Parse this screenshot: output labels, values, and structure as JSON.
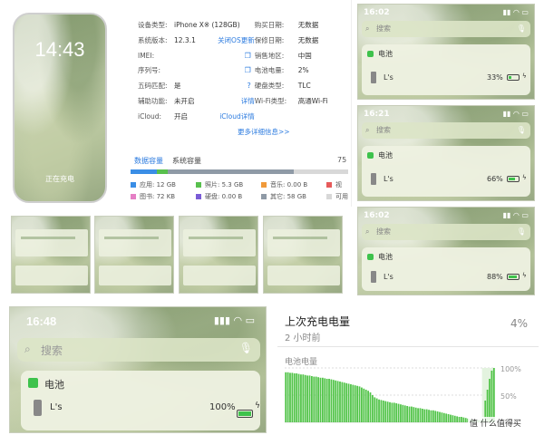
{
  "itools": {
    "lock_time": "14:43",
    "lock_status": "正在充电",
    "info": [
      {
        "k": "设备类型:",
        "v": "iPhone X※ (128GB)",
        "k2": "购买日期:",
        "v2": "无数据"
      },
      {
        "k": "系统版本:",
        "v": "12.3.1",
        "link": "关闭OS更新",
        "k2": "保修日期:",
        "v2": "无数据"
      },
      {
        "k": "IMEI:",
        "v": "",
        "copy": "❐",
        "k2": "销售地区:",
        "v2": "中国"
      },
      {
        "k": "序列号:",
        "v": "",
        "copy": "❐",
        "k2": "电池电量:",
        "v2": "2%"
      },
      {
        "k": "五码匹配:",
        "v": "是",
        "copy": "?",
        "k2": "硬盘类型:",
        "v2": "TLC"
      },
      {
        "k": "辅助功能:",
        "v": "未开启",
        "link": "详情",
        "k2": "Wi-Fi类型:",
        "v2": "高通Wi-Fi"
      },
      {
        "k": "iCloud:",
        "v": "开启",
        "link": "iCloud详情",
        "k2": "",
        "v2": ""
      }
    ],
    "more": "更多详细信息>>",
    "tab_data": "数据容量",
    "tab_system": "系统容量",
    "tab_total": "75",
    "legend": [
      {
        "label": "应用: 12 GB",
        "color": "#3a8ee6"
      },
      {
        "label": "照片: 5.3 GB",
        "color": "#58c04d"
      },
      {
        "label": "音乐: 0.00 B",
        "color": "#f09a3a"
      },
      {
        "label": "视",
        "color": "#e65a5a"
      },
      {
        "label": "图书: 72 KB",
        "color": "#e57fc5"
      },
      {
        "label": "硬盘: 0.00 B",
        "color": "#7a5cd6"
      },
      {
        "label": "其它: 58 GB",
        "color": "#8f9aa6"
      },
      {
        "label": "可用",
        "color": "#d8d8d8"
      }
    ]
  },
  "widgets_right": [
    {
      "time": "16:02",
      "percent": "33%",
      "level": 33
    },
    {
      "time": "16:21",
      "percent": "66%",
      "level": 66
    },
    {
      "time": "16:02",
      "percent": "88%",
      "level": 88
    }
  ],
  "widget_common": {
    "search_placeholder": "搜索",
    "battery_title": "电池",
    "device_label": "L's "
  },
  "big_widget": {
    "time": "16:48",
    "percent": "100%",
    "level": 100
  },
  "battery_panel": {
    "title": "上次充电电量",
    "value": "4%",
    "subtitle": "2 小时前",
    "chart_label": "电池电量",
    "y_ticks": [
      "100%",
      "50%"
    ],
    "watermark": "值 什么值得买"
  },
  "chart_data": {
    "type": "bar",
    "title": "电池电量",
    "ylim": [
      0,
      100
    ],
    "values": [
      92,
      92,
      91,
      91,
      90,
      90,
      89,
      88,
      88,
      87,
      86,
      86,
      85,
      84,
      84,
      83,
      82,
      82,
      81,
      80,
      80,
      79,
      78,
      77,
      76,
      75,
      74,
      73,
      72,
      71,
      70,
      69,
      68,
      67,
      66,
      64,
      62,
      60,
      58,
      55,
      50,
      46,
      44,
      42,
      41,
      40,
      39,
      38,
      37,
      36,
      36,
      35,
      34,
      33,
      32,
      31,
      30,
      29,
      29,
      28,
      27,
      26,
      26,
      25,
      24,
      24,
      23,
      22,
      22,
      21,
      20,
      19,
      18,
      17,
      16,
      15,
      14,
      13,
      12,
      11,
      10,
      10,
      9,
      8,
      7,
      6,
      5,
      4,
      4,
      4,
      4,
      4,
      40,
      60,
      80,
      95,
      100
    ]
  }
}
